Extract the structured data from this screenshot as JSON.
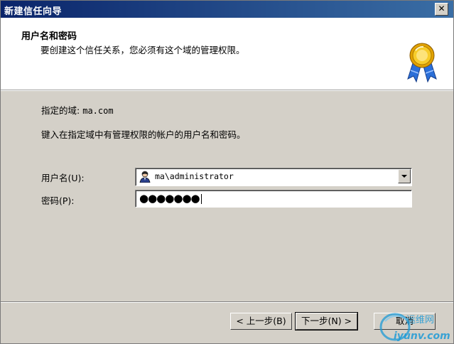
{
  "window": {
    "title": "新建信任向导",
    "close_glyph": "✕"
  },
  "header": {
    "title": "用户名和密码",
    "subtitle": "要创建这个信任关系，您必须有这个域的管理权限。",
    "icon": "award-ribbon-icon"
  },
  "content": {
    "domain_label": "指定的域:",
    "domain_value": "ma.com",
    "instruction": "键入在指定域中有管理权限的帐户的用户名和密码。"
  },
  "form": {
    "username_label": "用户名(U):",
    "username_value": "ma\\administrator",
    "password_label": "密码(P):",
    "password_mask": "●●●●●●●"
  },
  "buttons": {
    "back": "< 上一步(B)",
    "next": "下一步(N) >",
    "cancel": "取消"
  },
  "watermark": {
    "brand_cn": "运维网",
    "brand_url": "iyunv.com"
  },
  "colors": {
    "titlebar_start": "#0a246a",
    "titlebar_end": "#3a6ea5",
    "face": "#d4d0c8"
  }
}
